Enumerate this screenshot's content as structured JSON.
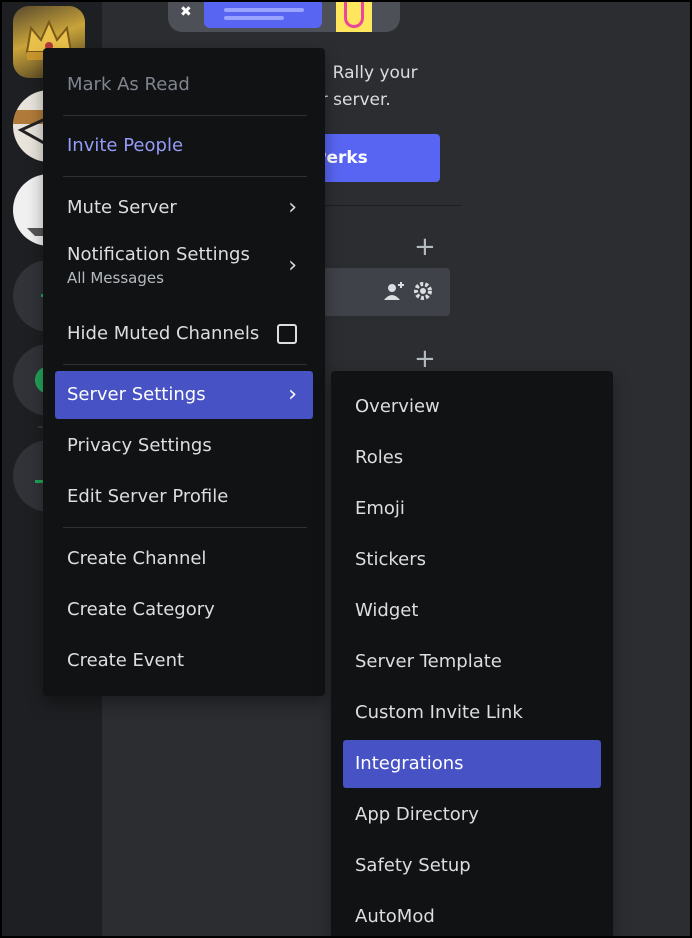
{
  "channel_panel": {
    "boost_text_line1": "e! Rally your",
    "boost_text_line2": "ur server.",
    "boost_button": "Perks",
    "add_icon": "+",
    "invite_icon": "add-person-icon",
    "settings_icon": "gear-icon"
  },
  "menu": {
    "mark_as_read": "Mark As Read",
    "invite_people": "Invite People",
    "mute_server": "Mute Server",
    "notification_settings": "Notification Settings",
    "notification_value": "All Messages",
    "hide_muted_channels": "Hide Muted Channels",
    "server_settings": "Server Settings",
    "privacy_settings": "Privacy Settings",
    "edit_server_profile": "Edit Server Profile",
    "create_channel": "Create Channel",
    "create_category": "Create Category",
    "create_event": "Create Event",
    "chevron": "›"
  },
  "submenu": {
    "items": [
      "Overview",
      "Roles",
      "Emoji",
      "Stickers",
      "Widget",
      "Server Template",
      "Custom Invite Link",
      "Integrations",
      "App Directory",
      "Safety Setup",
      "AutoMod"
    ],
    "active": "Integrations"
  },
  "colors": {
    "accent": "#5865f2",
    "active_item": "#4752c4",
    "menu_bg": "#111214"
  }
}
